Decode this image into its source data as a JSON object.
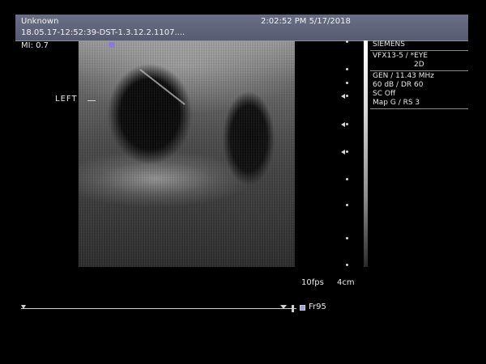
{
  "header": {
    "patient": "Unknown",
    "timestamp": "2:02:52 PM 5/17/2018",
    "study_id": "18.05.17-12:52:39-DST-1.3.12.2.1107...."
  },
  "mi": "MI: 0.7",
  "orientation_label": "LEFT",
  "info_panel": {
    "lines": [
      "SIEMENS",
      "VFX13-5 / *EYE",
      "2D",
      "GEN / 11.43 MHz",
      "60 dB / DR 60",
      "SC Off",
      "Map G / RS 3"
    ]
  },
  "frame_rate": "10fps",
  "depth": "4cm",
  "cine": {
    "frame_label": "Fr95"
  },
  "icons": {
    "depth_marker": "depth-marker-icon",
    "focus_arrow": "focus-arrow-icon",
    "frame": "frame-icon"
  },
  "colors": {
    "header_bg": "#5f6379",
    "marker": "#8c7bd1"
  }
}
